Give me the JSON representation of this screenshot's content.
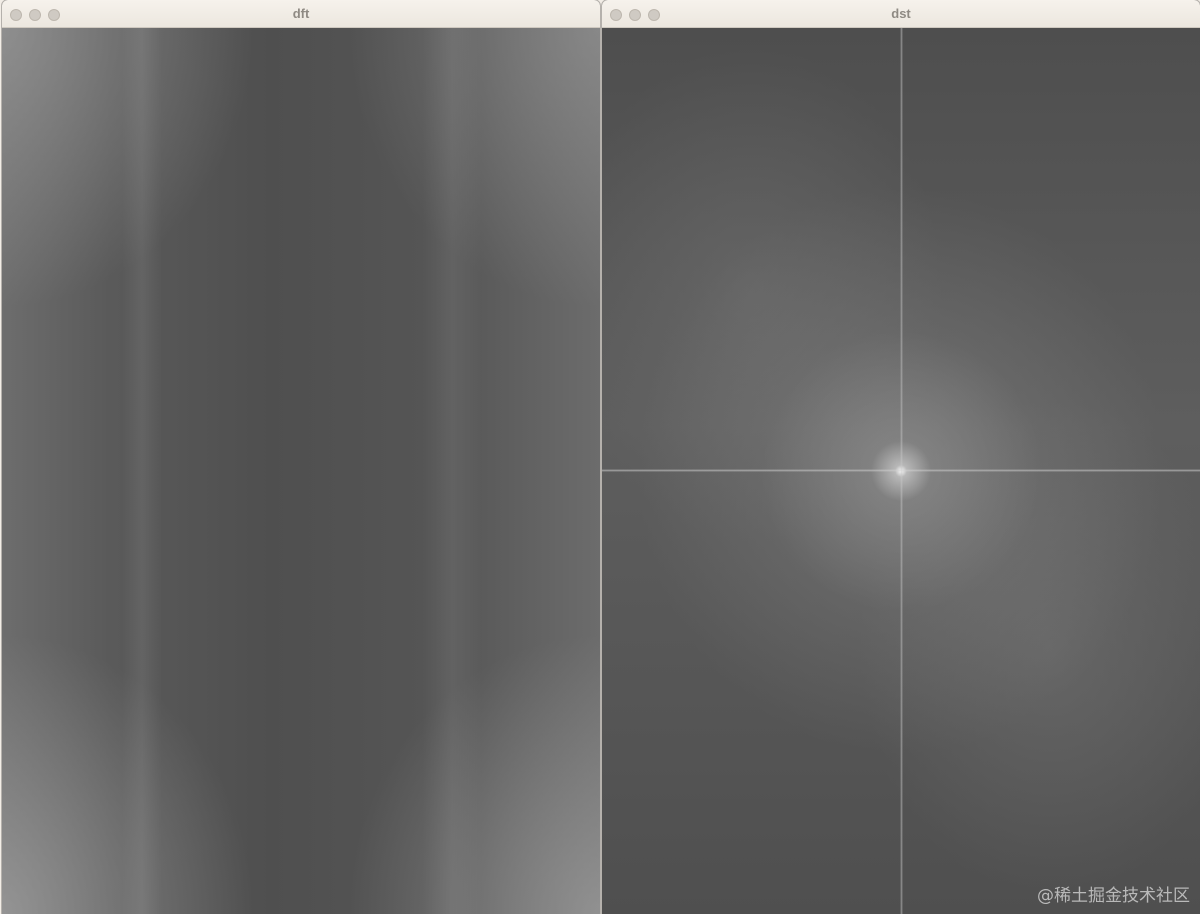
{
  "windows": [
    {
      "title": "dft",
      "traffic_lights": [
        "close-button",
        "minimize-button",
        "zoom-button"
      ]
    },
    {
      "title": "dst",
      "traffic_lights": [
        "close-button",
        "minimize-button",
        "zoom-button"
      ]
    }
  ],
  "watermark": "@稀土掘金技术社区",
  "colors": {
    "titlebar": "#efeae3",
    "title_text": "#8f8a83",
    "traffic_light": "#cfcac3",
    "image_gray": "#555555"
  }
}
